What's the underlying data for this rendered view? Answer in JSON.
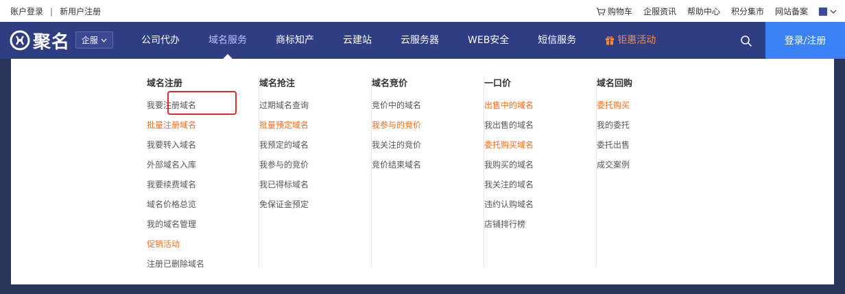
{
  "topbar": {
    "login": "账户登录",
    "separator": "|",
    "register": "新用户注册",
    "cart": "购物车",
    "news": "企服资讯",
    "help": "帮助中心",
    "points": "积分集市",
    "icp": "网站备案"
  },
  "nav": {
    "logo": "聚名",
    "qifu": "企服",
    "items": [
      {
        "label": "公司代办"
      },
      {
        "label": "域名服务"
      },
      {
        "label": "商标知产"
      },
      {
        "label": "云建站"
      },
      {
        "label": "云服务器"
      },
      {
        "label": "WEB安全"
      },
      {
        "label": "短信服务"
      },
      {
        "label": "钜惠活动"
      }
    ],
    "login_button": "登录/注册"
  },
  "dropdown": {
    "columns": [
      {
        "title": "域名注册",
        "items": [
          {
            "label": "我要注册域名",
            "highlight": false
          },
          {
            "label": "批量注册域名",
            "highlight": true
          },
          {
            "label": "我要转入域名",
            "highlight": false
          },
          {
            "label": "外部域名入库",
            "highlight": false
          },
          {
            "label": "我要续费域名",
            "highlight": false
          },
          {
            "label": "域名价格总览",
            "highlight": false
          },
          {
            "label": "我的域名管理",
            "highlight": false
          },
          {
            "label": "促销活动",
            "highlight": true
          },
          {
            "label": "注册已删除域名",
            "highlight": false
          }
        ]
      },
      {
        "title": "域名抢注",
        "items": [
          {
            "label": "过期域名查询",
            "highlight": false
          },
          {
            "label": "批量预定域名",
            "highlight": true
          },
          {
            "label": "我预定的域名",
            "highlight": false
          },
          {
            "label": "我参与的竞价",
            "highlight": false
          },
          {
            "label": "我已得标域名",
            "highlight": false
          },
          {
            "label": "免保证金预定",
            "highlight": false
          }
        ]
      },
      {
        "title": "域名竞价",
        "items": [
          {
            "label": "竞价中的域名",
            "highlight": false
          },
          {
            "label": "我参与的竞价",
            "highlight": true
          },
          {
            "label": "我关注的竞价",
            "highlight": false
          },
          {
            "label": "竞价结束域名",
            "highlight": false
          }
        ]
      },
      {
        "title": "一口价",
        "items": [
          {
            "label": "出售中的域名",
            "highlight": true
          },
          {
            "label": "我出售的域名",
            "highlight": false
          },
          {
            "label": "委托购买域名",
            "highlight": true
          },
          {
            "label": "我购买的域名",
            "highlight": false
          },
          {
            "label": "我关注的域名",
            "highlight": false
          },
          {
            "label": "违约认购域名",
            "highlight": false
          },
          {
            "label": "店铺排行榜",
            "highlight": false
          }
        ]
      },
      {
        "title": "域名回购",
        "items": [
          {
            "label": "委托购买",
            "highlight": true
          },
          {
            "label": "我的委托",
            "highlight": false
          },
          {
            "label": "委托出售",
            "highlight": false
          },
          {
            "label": "成交案例",
            "highlight": false
          }
        ]
      }
    ]
  },
  "colors": {
    "nav_bg": "#2f3d83",
    "login_bg": "#3b82f6",
    "highlight": "#f26b1d",
    "annotation": "#e8262a"
  },
  "icons": [
    "cart-icon",
    "chevron-down-icon",
    "logo-icon",
    "gift-icon",
    "search-icon",
    "language-flag-icon"
  ]
}
